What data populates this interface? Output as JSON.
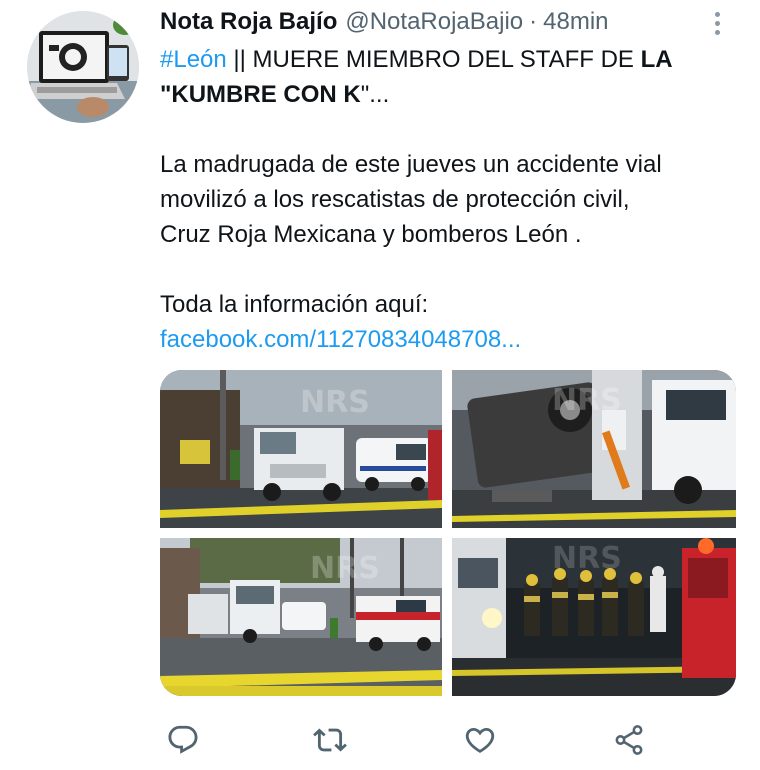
{
  "tweet": {
    "display_name": "Nota Roja Bajío",
    "handle": "@NotaRojaBajio",
    "separator": "·",
    "time": "48min",
    "hashtag": "#León",
    "headline_plain": " || MUERE MIEMBRO DEL STAFF DE ",
    "headline_bold_1": "LA",
    "headline_bold_2": "\"KUMBRE CON K",
    "headline_end": "\"...",
    "paragraph_line_1": "La madrugada de este jueves un accidente vial",
    "paragraph_line_2": "movilizó a los rescatistas de protección civil,",
    "paragraph_line_3": "Cruz Roja Mexicana y bomberos León .",
    "info_label": "Toda la información aquí:",
    "link_text": "facebook.com/11270834048708..."
  },
  "media": {
    "photo_count": 4,
    "watermark": "NRS"
  },
  "actions": {
    "icons": [
      "reply-icon",
      "retweet-icon",
      "like-icon",
      "share-icon"
    ]
  },
  "colors": {
    "link": "#1d9bf0",
    "text": "#0f1419",
    "secondary": "#536471",
    "icon": "#536471"
  }
}
